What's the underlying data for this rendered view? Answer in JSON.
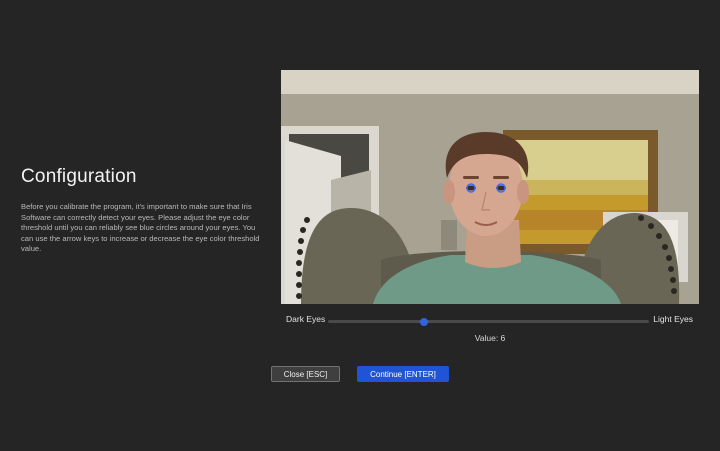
{
  "config": {
    "title": "Configuration",
    "description": "Before you calibrate the program, it's important to make sure that Iris Software can correctly detect your eyes. Please adjust the eye color threshold until you can reliably see blue circles around your eyes. You can use the arrow keys to increase or decrease the eye color threshold value."
  },
  "camera": {
    "feed_description": "webcam-preview"
  },
  "slider": {
    "left_label": "Dark Eyes",
    "right_label": "Light Eyes",
    "value_prefix": "Value:",
    "value": 6,
    "value_text": "Value: 6",
    "min": 0,
    "max": 20,
    "fraction": 0.3
  },
  "buttons": {
    "close_label": "Close [ESC]",
    "continue_label": "Continue [ENTER]"
  },
  "colors": {
    "background": "#252526",
    "accent": "#1f54d6",
    "eye_circle": "#3b6cff"
  }
}
